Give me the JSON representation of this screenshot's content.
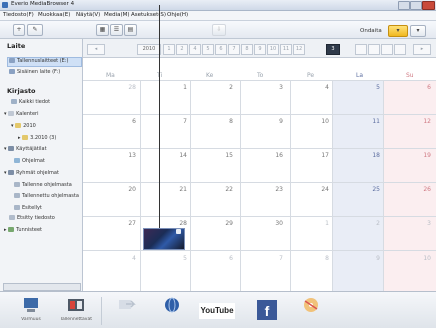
{
  "window": {
    "title": "Everio MediaBrowser 4"
  },
  "menu": [
    "Tiedosto(F)",
    "Muokkaa(E)",
    "Näytä(V)",
    "Media(M)",
    "Asetukset(S)",
    "Ohje(H)"
  ],
  "toolbar": {
    "date_label": "Ondaita"
  },
  "left": {
    "section1": "Laite",
    "device_items": [
      "Tallennuslaitteet (E:)",
      "Sisäinen laite (F:)"
    ],
    "section2": "Kirjasto",
    "tree": [
      "Kaikki tiedot",
      "Kalenteri",
      "2010",
      "3.2010 (3)",
      "Käyttäjätilat",
      "Ohjelmat",
      "Ryhmät ohjelmat",
      "Tallenne ohjelmasta",
      "Tallennettu ohjelmasta",
      "Esitellyt",
      "Etsitty tiedosto",
      "Tunnisteet"
    ]
  },
  "calendar": {
    "selected_month": "3",
    "weekdays": [
      "Ma",
      "Ti",
      "Ke",
      "To",
      "Pe",
      "La",
      "Su"
    ],
    "weeks": [
      [
        "28",
        "1",
        "2",
        "3",
        "4",
        "5",
        "6"
      ],
      [
        "6",
        "7",
        "8",
        "9",
        "10",
        "11",
        "12"
      ],
      [
        "13",
        "14",
        "15",
        "16",
        "17",
        "18",
        "19"
      ],
      [
        "20",
        "21",
        "22",
        "23",
        "24",
        "25",
        "26"
      ],
      [
        "27",
        "28",
        "29",
        "30",
        "1",
        "2",
        "3"
      ],
      [
        "4",
        "5",
        "6",
        "7",
        "8",
        "9",
        "10"
      ]
    ]
  },
  "bottom": {
    "buttons": [
      {
        "label": "Varmuus",
        "icon": "disc-icon"
      },
      {
        "label": "Tallennettavat",
        "icon": "film-edit-icon"
      },
      {
        "label": "",
        "icon": "export-icon"
      },
      {
        "label": "",
        "icon": "upload-icon"
      },
      {
        "label": "",
        "icon": "youtube-icon",
        "text": "YouTube"
      },
      {
        "label": "",
        "icon": "facebook-icon",
        "text": "f"
      },
      {
        "label": "",
        "icon": "disc-create-icon"
      }
    ]
  }
}
